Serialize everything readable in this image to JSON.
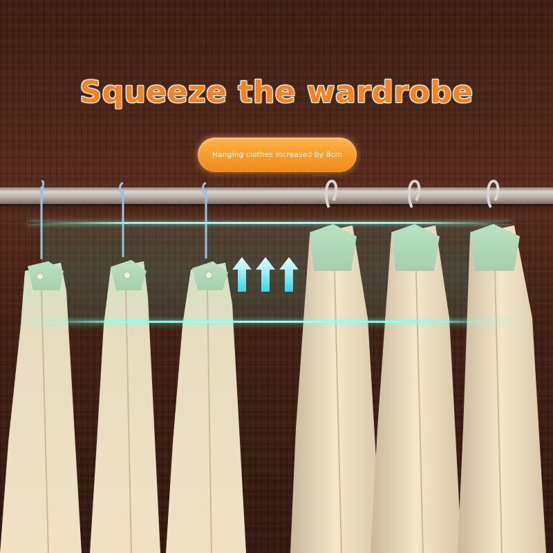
{
  "headline": "Squeeze the wardrobe",
  "badge": "Hanging clothes increased by 8cm",
  "colors": {
    "headline": "#f5821f",
    "badge_bg": "#f59a28",
    "glow": "#7ef5dc",
    "shirt_green": "#a9d8b6",
    "shirt_cream": "#ecdcbf",
    "hanger_blue": "#8ec5e8"
  },
  "icons": [
    "up-arrow-icon",
    "up-arrow-icon",
    "up-arrow-icon"
  ]
}
